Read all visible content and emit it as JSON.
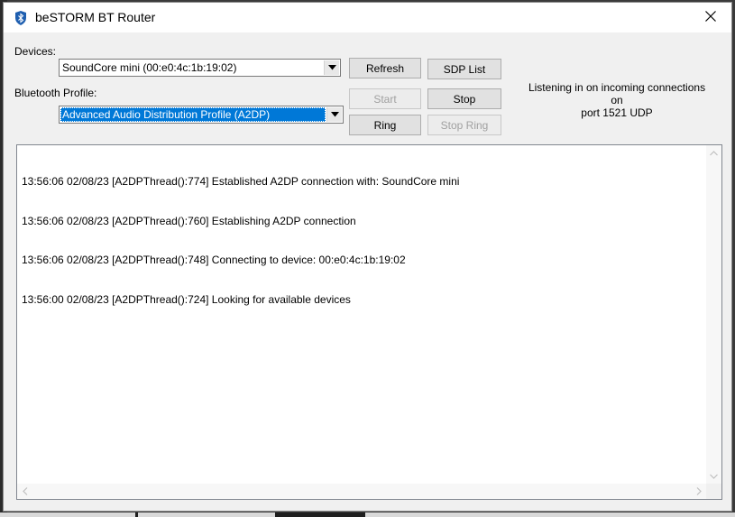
{
  "window": {
    "title": "beSTORM BT Router"
  },
  "devices": {
    "label": "Devices:",
    "selected": "SoundCore mini (00:e0:4c:1b:19:02)"
  },
  "profile": {
    "label": "Bluetooth Profile:",
    "selected": "Advanced Audio Distribution Profile (A2DP)"
  },
  "buttons": {
    "refresh": "Refresh",
    "sdp_list": "SDP List",
    "start": "Start",
    "stop": "Stop",
    "ring": "Ring",
    "stop_ring": "Stop Ring"
  },
  "status": {
    "line1": "Listening in on incoming connections on",
    "line2": "port 1521 UDP"
  },
  "log": {
    "lines": [
      "13:56:06 02/08/23 [A2DPThread():774] Established A2DP connection with: SoundCore mini",
      "13:56:06 02/08/23 [A2DPThread():760] Establishing A2DP connection",
      "13:56:06 02/08/23 [A2DPThread():748] Connecting to device: 00:e0:4c:1b:19:02",
      "13:56:00 02/08/23 [A2DPThread():724] Looking for available devices"
    ]
  },
  "colors": {
    "selection": "#0078d7",
    "window_bg": "#f0f0f0"
  },
  "icons": {
    "app": "bluetooth-shield-icon",
    "close": "close-icon"
  }
}
